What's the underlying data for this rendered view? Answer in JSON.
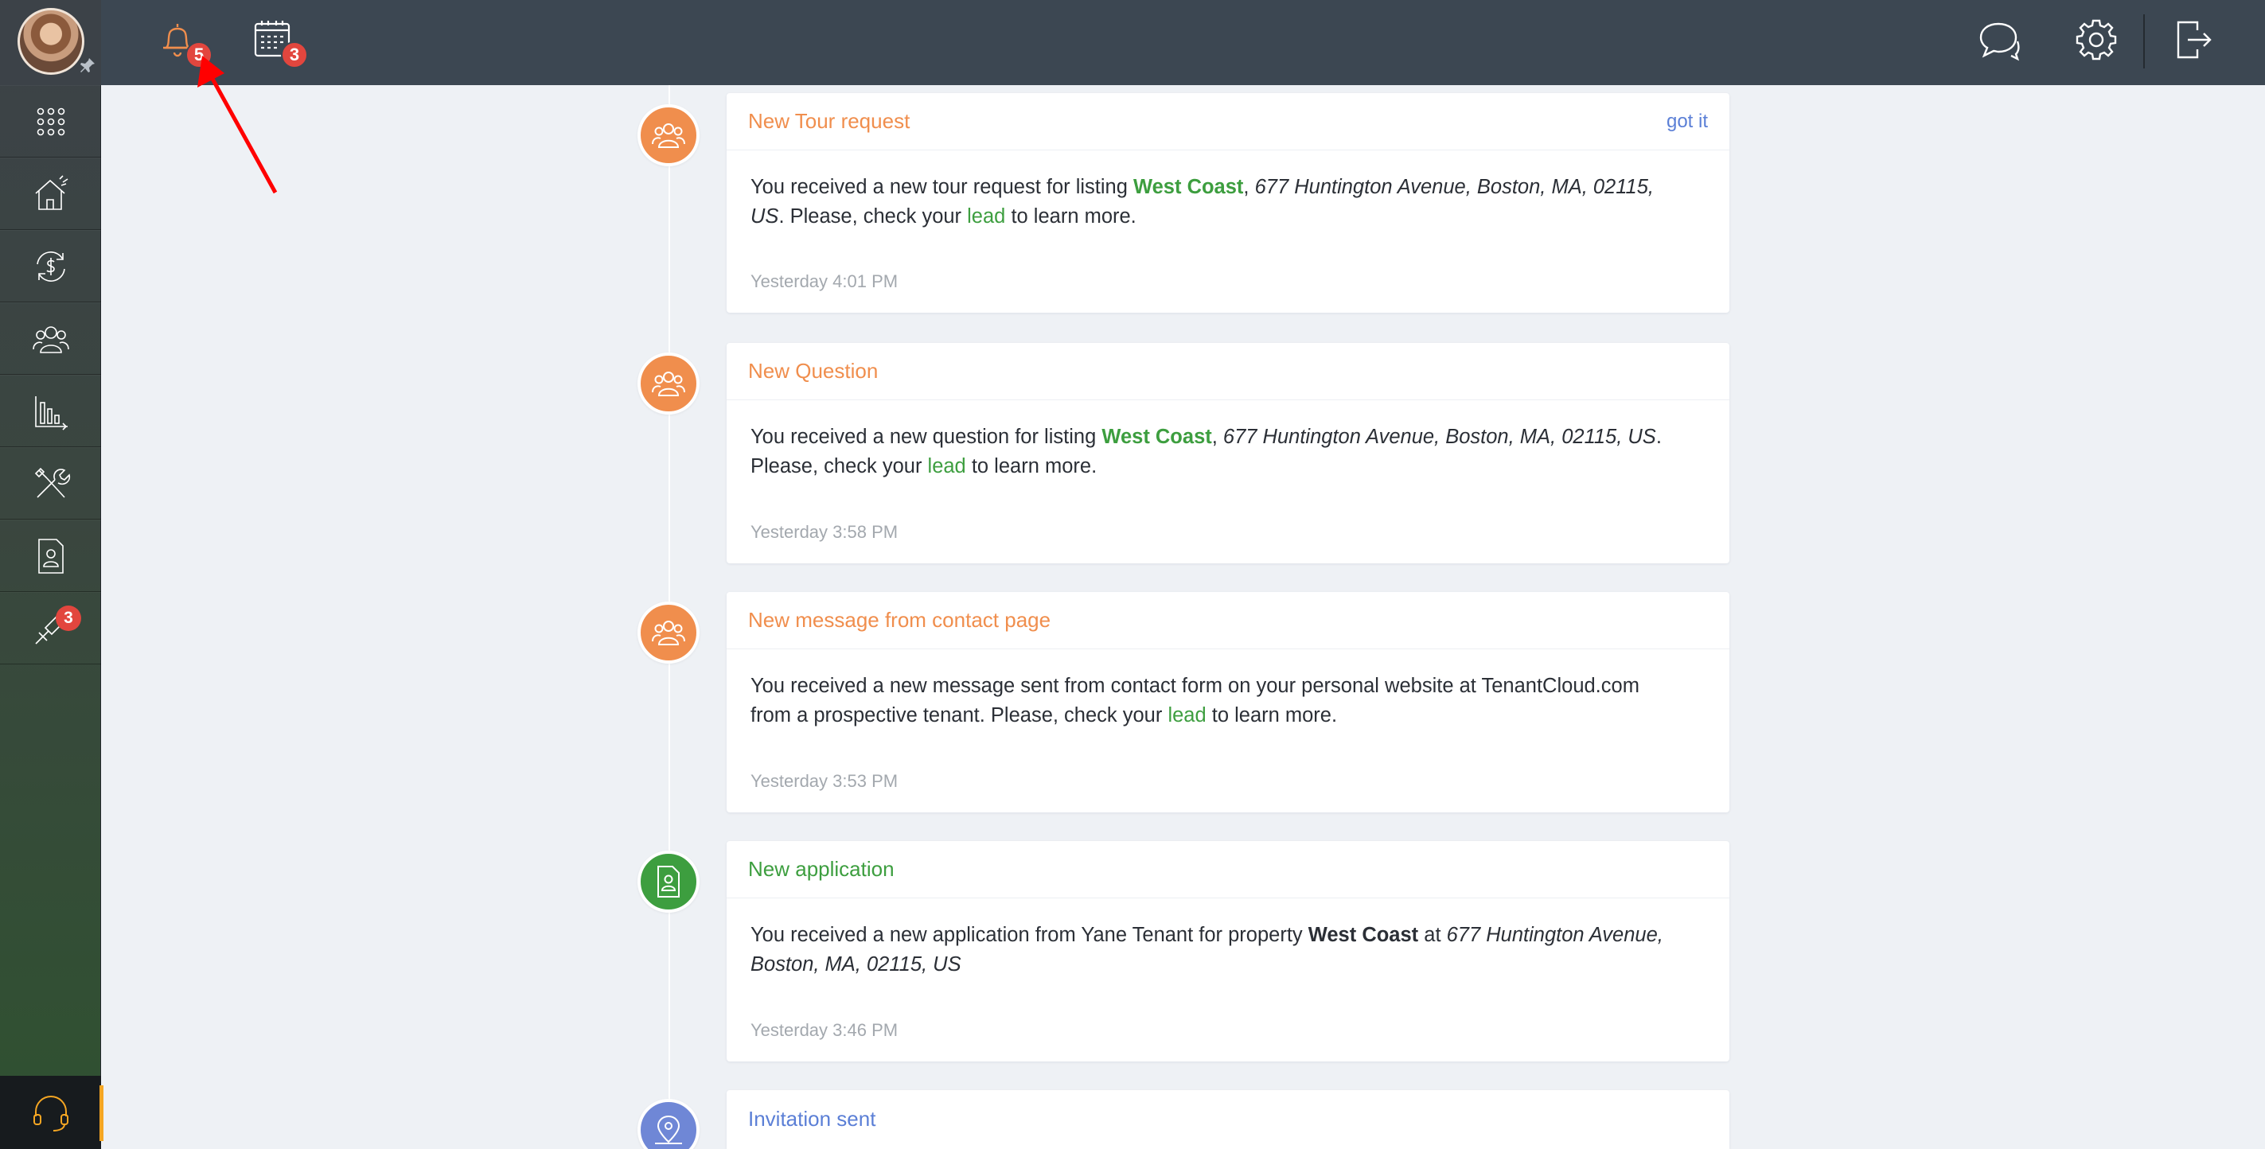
{
  "topbar": {
    "notifications_count": "5",
    "calendar_count": "3"
  },
  "sidebar": {
    "items": [
      {
        "icon": "apps-grid-icon"
      },
      {
        "icon": "properties-icon"
      },
      {
        "icon": "accounting-icon"
      },
      {
        "icon": "people-icon"
      },
      {
        "icon": "reports-icon"
      },
      {
        "icon": "maintenance-icon"
      },
      {
        "icon": "applications-icon"
      },
      {
        "icon": "tools-icon",
        "badge": "3"
      }
    ],
    "support_icon": "headset-icon"
  },
  "feed": [
    {
      "title": "New Tour request",
      "action": "got it",
      "text_before": "You received a new tour request for listing ",
      "listing": "West Coast",
      "text_mid": ", ",
      "address": "677 Huntington Avenue, Boston, MA, 02115, US",
      "text_after": ". Please, check your ",
      "lead": "lead",
      "text_end": " to learn more.",
      "time": "Yesterday 4:01 PM"
    },
    {
      "title": "New Question",
      "text_before": "You received a new question for listing ",
      "listing": "West Coast",
      "text_mid": ", ",
      "address": "677 Huntington Avenue, Boston, MA, 02115, US",
      "text_after": ". Please, check your ",
      "lead": "lead",
      "text_end": " to learn more.",
      "time": "Yesterday 3:58 PM"
    },
    {
      "title": "New message from contact page",
      "text_before": "You received a new message sent from contact form on your personal website at TenantCloud.com from a prospective tenant. Please, check your ",
      "lead": "lead",
      "text_end": " to learn more.",
      "time": "Yesterday 3:53 PM"
    },
    {
      "title": "New application",
      "text_before": "You received a new application from Yane Tenant for property ",
      "property": "West Coast",
      "text_mid": " at ",
      "address": "677 Huntington Avenue, Boston, MA, 02115, US",
      "time": "Yesterday 3:46 PM"
    },
    {
      "title": "Invitation sent"
    }
  ],
  "colors": {
    "orange": "#f08e4d",
    "green": "#3d9e3f",
    "blue": "#5b7fd6",
    "badge_red": "#e2463e"
  }
}
